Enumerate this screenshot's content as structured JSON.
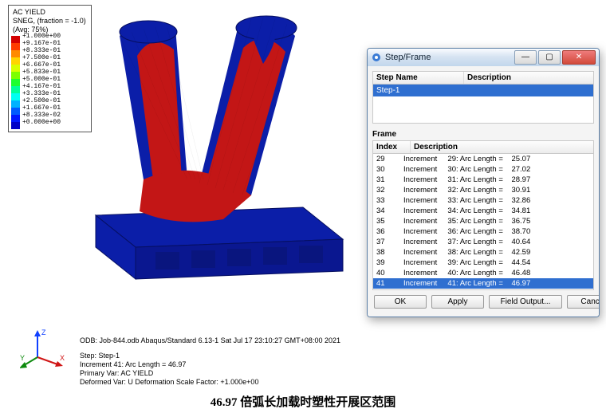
{
  "legend": {
    "title_l1": "AC YIELD",
    "title_l2": "SNEG, (fraction = -1.0)",
    "title_l3": "(Avg: 75%)",
    "entries": [
      {
        "color": "#d40000",
        "label": "+1.000e+00"
      },
      {
        "color": "#ff3b00",
        "label": "+9.167e-01"
      },
      {
        "color": "#ff8a00",
        "label": "+8.333e-01"
      },
      {
        "color": "#ffd400",
        "label": "+7.500e-01"
      },
      {
        "color": "#d8ff00",
        "label": "+6.667e-01"
      },
      {
        "color": "#7cff00",
        "label": "+5.833e-01"
      },
      {
        "color": "#1eff2e",
        "label": "+5.000e-01"
      },
      {
        "color": "#00ff98",
        "label": "+4.167e-01"
      },
      {
        "color": "#00fff2",
        "label": "+3.333e-01"
      },
      {
        "color": "#00b2ff",
        "label": "+2.500e-01"
      },
      {
        "color": "#005bff",
        "label": "+1.667e-01"
      },
      {
        "color": "#0018ff",
        "label": "+8.333e-02"
      },
      {
        "color": "#0000c8",
        "label": "+0.000e+00"
      }
    ]
  },
  "info": {
    "odb_line": "ODB: Job-844.odb    Abaqus/Standard 6.13-1    Sat Jul 17 23:10:27 GMT+08:00 2021",
    "step_line": "Step: Step-1",
    "incr_line": "Increment     41: Arc Length =    46.97",
    "primary_line": "Primary Var: AC YIELD",
    "def_line": "Deformed Var: U   Deformation Scale Factor: +1.000e+00"
  },
  "caption": "46.97 倍弧长加载时塑性开展区范围",
  "triad": {
    "x": "X",
    "y": "Y",
    "z": "Z"
  },
  "dialog": {
    "title": "Step/Frame",
    "cols": {
      "step": "Step Name",
      "desc": "Description"
    },
    "step_selected": "Step-1",
    "frame_label": "Frame",
    "frame_cols": {
      "idx": "Index",
      "desc": "Description"
    },
    "frames": [
      {
        "idx": "29",
        "desc": "Increment     29: Arc Length =    25.07"
      },
      {
        "idx": "30",
        "desc": "Increment     30: Arc Length =    27.02"
      },
      {
        "idx": "31",
        "desc": "Increment     31: Arc Length =    28.97"
      },
      {
        "idx": "32",
        "desc": "Increment     32: Arc Length =    30.91"
      },
      {
        "idx": "33",
        "desc": "Increment     33: Arc Length =    32.86"
      },
      {
        "idx": "34",
        "desc": "Increment     34: Arc Length =    34.81"
      },
      {
        "idx": "35",
        "desc": "Increment     35: Arc Length =    36.75"
      },
      {
        "idx": "36",
        "desc": "Increment     36: Arc Length =    38.70"
      },
      {
        "idx": "37",
        "desc": "Increment     37: Arc Length =    40.64"
      },
      {
        "idx": "38",
        "desc": "Increment     38: Arc Length =    42.59"
      },
      {
        "idx": "39",
        "desc": "Increment     39: Arc Length =    44.54"
      },
      {
        "idx": "40",
        "desc": "Increment     40: Arc Length =    46.48"
      },
      {
        "idx": "41",
        "desc": "Increment     41: Arc Length =    46.97",
        "selected": true
      }
    ],
    "buttons": {
      "ok": "OK",
      "apply": "Apply",
      "field": "Field Output...",
      "cancel": "Cancel"
    }
  }
}
